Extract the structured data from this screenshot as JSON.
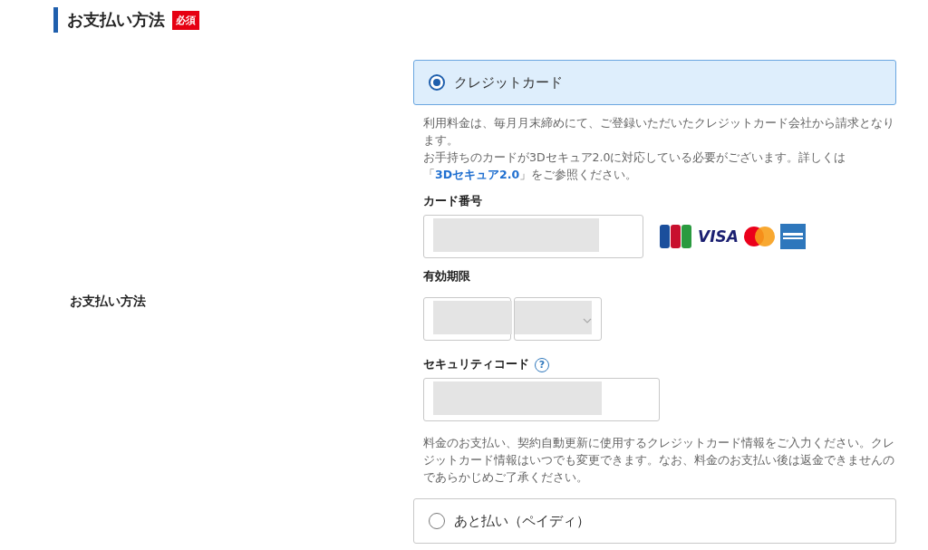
{
  "section": {
    "title": "お支払い方法",
    "required_badge": "必須"
  },
  "row_label": "お支払い方法",
  "methods": [
    {
      "label": "クレジットカード",
      "selected": true,
      "kind": "card"
    },
    {
      "label": "あと払い（ペイディ）",
      "selected": false,
      "kind": "plain"
    }
  ],
  "card_form": {
    "notes": [
      {
        "text": "利用料金は、毎月月末締めにて、ご登録いただいたクレジットカード会社から請求となります。"
      },
      {
        "before": "お手持ちのカードが3Dセキュア2.0に対応している必要がございます。詳しくは「",
        "link": "3Dセキュア2.0",
        "after": "」をご参照ください。"
      }
    ],
    "card_number_label": "カード番号",
    "brand_visa": "VISA",
    "expiry_label": "有効期限",
    "security_label": "セキュリティコード",
    "help_mark": "?",
    "footer_note": "料金のお支払い、契約自動更新に使用するクレジットカード情報をご入力ください。クレジットカード情報はいつでも変更できます。なお、料金のお支払い後は返金できませんのであらかじめご了承ください。"
  }
}
